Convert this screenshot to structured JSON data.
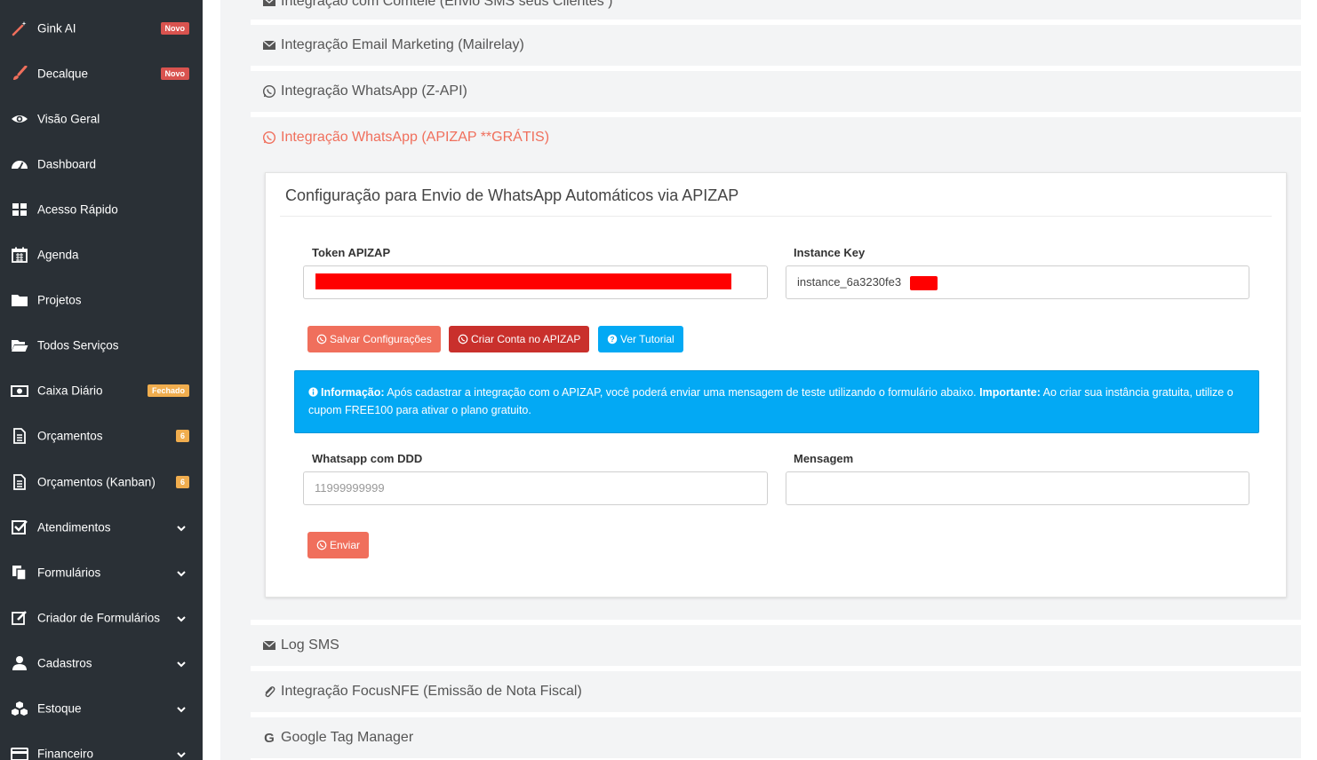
{
  "sidebar": {
    "items": [
      {
        "label": "Gink AI",
        "icon": "magic-wand-icon",
        "badge": "Novo",
        "badge_color": "#d9534f"
      },
      {
        "label": "Decalque",
        "icon": "paint-brush-icon",
        "badge": "Novo",
        "badge_color": "#d9534f"
      },
      {
        "label": "Visão Geral",
        "icon": "eye-icon"
      },
      {
        "label": "Dashboard",
        "icon": "dashboard-icon"
      },
      {
        "label": "Acesso Rápido",
        "icon": "grid-icon"
      },
      {
        "label": "Agenda",
        "icon": "calendar-icon"
      },
      {
        "label": "Projetos",
        "icon": "folder-icon"
      },
      {
        "label": "Todos Serviços",
        "icon": "folder-open-icon"
      },
      {
        "label": "Caixa Diário",
        "icon": "money-icon",
        "badge": "Fechado",
        "badge_color": "#f0ad4e"
      },
      {
        "label": "Orçamentos",
        "icon": "document-icon",
        "badge": "6",
        "badge_color": "#f0ad4e"
      },
      {
        "label": "Orçamentos (Kanban)",
        "icon": "document-icon",
        "badge": "6",
        "badge_color": "#f0ad4e"
      },
      {
        "label": "Atendimentos",
        "icon": "check-square-icon",
        "chevron": true
      },
      {
        "label": "Formulários",
        "icon": "copy-icon",
        "chevron": true
      },
      {
        "label": "Criador de Formulários",
        "icon": "edit-icon",
        "chevron": true
      },
      {
        "label": "Cadastros",
        "icon": "user-icon",
        "chevron": true
      },
      {
        "label": "Estoque",
        "icon": "cubes-icon",
        "chevron": true
      },
      {
        "label": "Financeiro",
        "icon": "credit-card-icon",
        "chevron": true
      }
    ]
  },
  "accordions": {
    "comtele": "Integração com Comtele (Envio SMS seus Clientes )",
    "mailrelay": "Integração Email Marketing (Mailrelay)",
    "zapi": "Integração WhatsApp (Z-API)",
    "apizap": "Integração WhatsApp (APIZAP **GRÁTIS)",
    "log_sms": "Log SMS",
    "focusnfe": "Integração FocusNFE (Emissão de Nota Fiscal)",
    "gtm": "Google Tag Manager"
  },
  "apizap": {
    "card_title": "Configuração para Envio de WhatsApp Automáticos via APIZAP",
    "token_label": "Token APIZAP",
    "token_value": "",
    "instance_label": "Instance Key",
    "instance_value": "instance_6a3230fe3",
    "save_button": "Salvar Configurações",
    "create_button": "Criar Conta no APIZAP",
    "tutorial_button": "Ver Tutorial",
    "alert": {
      "info_label": "Informação:",
      "info_text": " Após cadastrar a integração com o APIZAP, você poderá enviar uma mensagem de teste utilizando o formulário abaixo. ",
      "important_label": "Importante:",
      "important_text": " Ao criar sua instância gratuita, utilize o cupom FREE100 para ativar o plano gratuito."
    },
    "whatsapp_label": "Whatsapp com DDD",
    "whatsapp_placeholder": "11999999999",
    "message_label": "Mensagem",
    "message_value": "",
    "send_button": "Enviar"
  },
  "colors": {
    "sidebar_bg": "#2a3036",
    "accent": "#f06f5c",
    "create_btn": "#c9302c",
    "tutorial_btn": "#03a9f4",
    "alert_bg": "#03a9f4"
  }
}
